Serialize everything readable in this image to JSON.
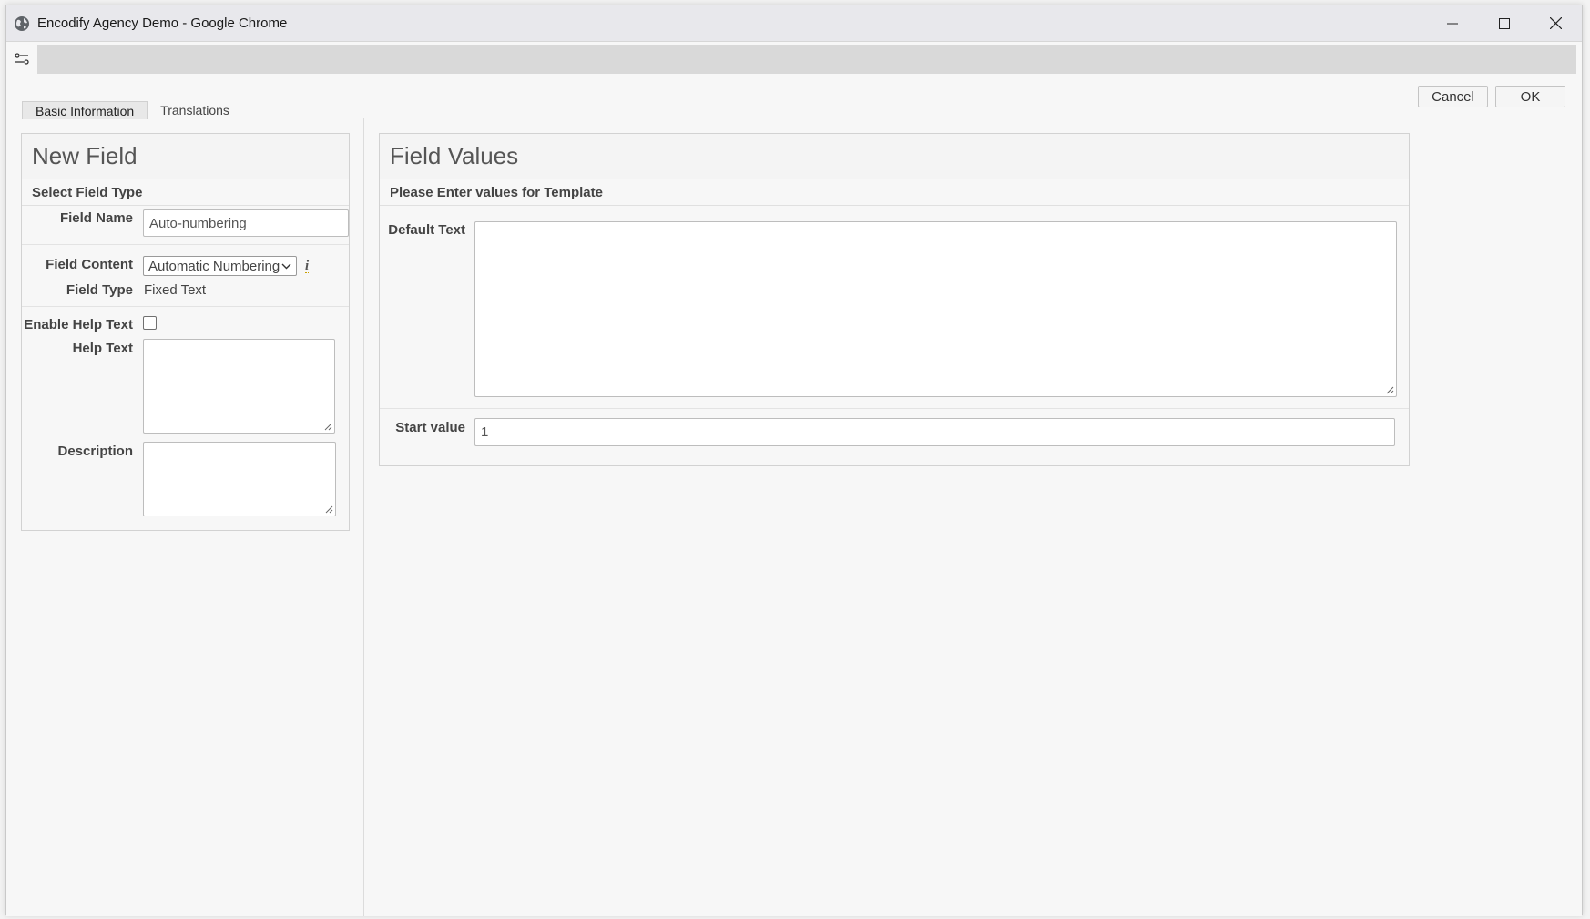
{
  "window": {
    "title": "Encodify Agency Demo - Google Chrome",
    "controls": {
      "minimize_icon": "minimize-icon",
      "maximize_icon": "maximize-icon",
      "close_icon": "close-icon"
    }
  },
  "toolbar": {
    "cancel_label": "Cancel",
    "ok_label": "OK"
  },
  "tabs": [
    {
      "label": "Basic Information",
      "active": true
    },
    {
      "label": "Translations",
      "active": false
    }
  ],
  "left_panel": {
    "title": "New Field",
    "subtitle": "Select Field Type",
    "field_name_label": "Field Name",
    "field_name_value": "Auto-numbering",
    "field_content_label": "Field Content",
    "field_content_value": "Automatic Numbering",
    "field_type_label": "Field Type",
    "field_type_value": "Fixed Text",
    "enable_help_label": "Enable Help Text",
    "enable_help_checked": false,
    "help_text_label": "Help Text",
    "description_label": "Description"
  },
  "right_panel": {
    "title": "Field Values",
    "subtitle": "Please Enter values for Template",
    "default_text_label": "Default Text",
    "start_value_label": "Start value",
    "start_value": "1"
  }
}
